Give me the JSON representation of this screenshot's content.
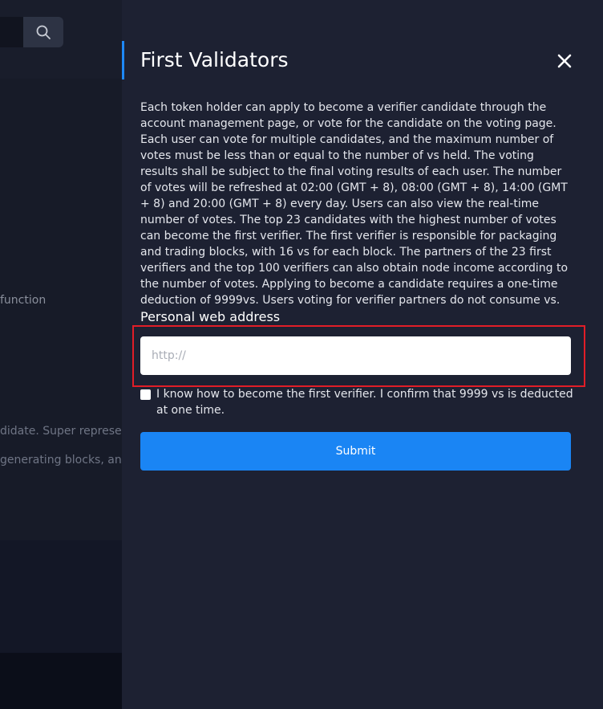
{
  "background_page": {
    "text_lines": [
      "function",
      "didate. Super represent",
      "generating blocks, and e"
    ]
  },
  "drawer": {
    "title": "First Validators",
    "description": "Each token holder can apply to become a verifier candidate through the account management page, or vote for the candidate on the voting page. Each user can vote for multiple candidates, and the maximum number of votes must be less than or equal to the number of vs held. The voting results shall be subject to the final voting results of each user. The number of votes will be refreshed at 02:00 (GMT + 8), 08:00 (GMT + 8), 14:00 (GMT + 8) and 20:00 (GMT + 8) every day. Users can also view the real-time number of votes. The top 23 candidates with the highest number of votes can become the first verifier. The first verifier is responsible for packaging and trading blocks, with 16 vs for each block. The partners of the 23 first verifiers and the top 100 verifiers can also obtain node income according to the number of votes. Applying to become a candidate requires a one-time deduction of 9999vs. Users voting for verifier partners do not consume vs.",
    "web_address": {
      "label": "Personal web address",
      "value": "",
      "placeholder": "http://"
    },
    "confirm_text": "I know how to become the first verifier. I confirm that 9999 vs is deducted at one time.",
    "submit_label": "Submit"
  },
  "colors": {
    "accent": "#1e88f6",
    "submit": "#1a85f4",
    "highlight": "#e11d27",
    "drawer_bg": "#1d2132"
  }
}
